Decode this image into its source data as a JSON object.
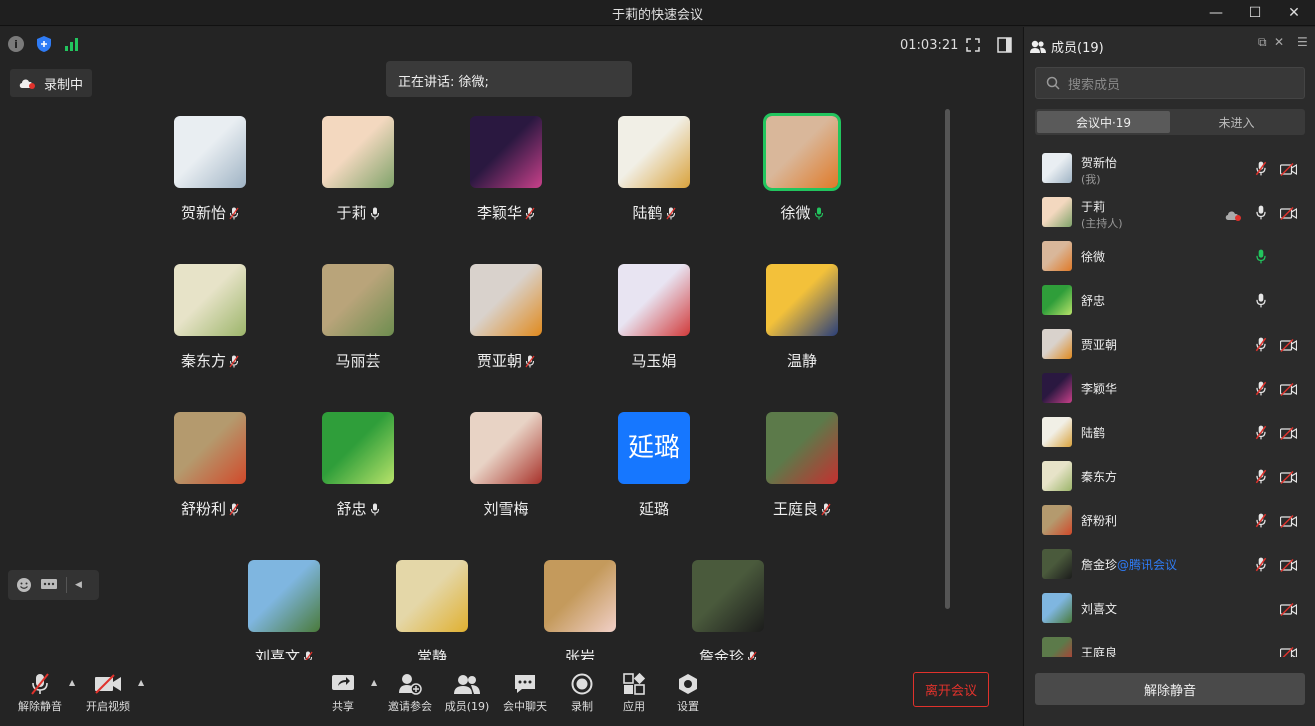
{
  "window": {
    "title": "于莉的快速会议"
  },
  "header": {
    "timer": "01:03:21",
    "recording_label": "录制中",
    "speaking_label": "正在讲话: 徐微;"
  },
  "colors": {
    "accent_green": "#22c55e",
    "danger_red": "#e0322c",
    "link_blue": "#2f7cf6"
  },
  "grid": [
    {
      "name": "贺新怡",
      "mic": "muted",
      "av": [
        "#e9eef2",
        "#9fb3c4"
      ]
    },
    {
      "name": "于莉",
      "mic": "on",
      "av": [
        "#f3d8bf",
        "#7fa36a"
      ]
    },
    {
      "name": "李颖华",
      "mic": "muted",
      "av": [
        "#2a1840",
        "#c8408a"
      ]
    },
    {
      "name": "陆鹤",
      "mic": "muted",
      "av": [
        "#f1efe6",
        "#d9a23c"
      ]
    },
    {
      "name": "徐微",
      "mic": "talking",
      "av": [
        "#d9b79a",
        "#e07a28"
      ],
      "active": true
    },
    {
      "name": "秦东方",
      "mic": "muted",
      "av": [
        "#e7e3c8",
        "#9cb56a"
      ]
    },
    {
      "name": "马丽芸",
      "mic": "none",
      "av": [
        "#b9a47a",
        "#6d8d4f"
      ]
    },
    {
      "name": "贾亚朝",
      "mic": "muted",
      "av": [
        "#d9d2cc",
        "#e08a1e"
      ]
    },
    {
      "name": "马玉娟",
      "mic": "none",
      "av": [
        "#e8e4f2",
        "#d13a3a"
      ]
    },
    {
      "name": "温静",
      "mic": "none",
      "av": [
        "#f3c13a",
        "#2a3f7a"
      ]
    },
    {
      "name": "舒粉利",
      "mic": "muted",
      "av": [
        "#b49a6e",
        "#d1492a"
      ]
    },
    {
      "name": "舒忠",
      "mic": "on",
      "av": [
        "#2f9e3a",
        "#b8e36a"
      ]
    },
    {
      "name": "刘雪梅",
      "mic": "none",
      "av": [
        "#e8d3c5",
        "#a8322a"
      ]
    },
    {
      "name": "延璐",
      "mic": "none",
      "av": [
        "#1677ff",
        "#1677ff"
      ],
      "text": "延璐"
    },
    {
      "name": "王庭良",
      "mic": "muted",
      "av": [
        "#5c7a4a",
        "#c53030"
      ]
    },
    {
      "name": "刘喜文",
      "mic": "muted",
      "av": [
        "#7fb6e0",
        "#4a7a3a"
      ]
    },
    {
      "name": "常静",
      "mic": "none",
      "av": [
        "#e4d7a8",
        "#e0b030"
      ]
    },
    {
      "name": "张岩",
      "mic": "none",
      "av": [
        "#c49a5c",
        "#f1d0c8"
      ]
    },
    {
      "name": "詹金珍",
      "mic": "muted",
      "av": [
        "#4a5a3c",
        "#1c1c1c"
      ]
    }
  ],
  "toolbar": {
    "unmute": "解除静音",
    "start_video": "开启视频",
    "share": "共享",
    "invite": "邀请参会",
    "members": "成员(19)",
    "chat": "会中聊天",
    "record": "录制",
    "apps": "应用",
    "settings": "设置",
    "leave": "离开会议"
  },
  "sidebar": {
    "title": "成员(19)",
    "search_placeholder": "搜索成员",
    "tab_in": "会议中·19",
    "tab_out": "未进入",
    "unmute_all": "解除静音",
    "members": [
      {
        "name": "贺新怡",
        "sub": "(我)",
        "mic": "muted",
        "cam": "off",
        "av": [
          "#e9eef2",
          "#9fb3c4"
        ]
      },
      {
        "name": "于莉",
        "sub": "(主持人)",
        "mic": "on",
        "cam": "off",
        "cloud": true,
        "av": [
          "#f3d8bf",
          "#7fa36a"
        ]
      },
      {
        "name": "徐微",
        "mic": "talking",
        "cam": "none",
        "av": [
          "#d9b79a",
          "#e07a28"
        ]
      },
      {
        "name": "舒忠",
        "mic": "on",
        "cam": "none",
        "av": [
          "#2f9e3a",
          "#b8e36a"
        ]
      },
      {
        "name": "贾亚朝",
        "mic": "muted",
        "cam": "off",
        "av": [
          "#d9d2cc",
          "#e08a1e"
        ]
      },
      {
        "name": "李颖华",
        "mic": "muted",
        "cam": "off",
        "av": [
          "#2a1840",
          "#c8408a"
        ]
      },
      {
        "name": "陆鹤",
        "mic": "muted",
        "cam": "off",
        "av": [
          "#f1efe6",
          "#d9a23c"
        ]
      },
      {
        "name": "秦东方",
        "mic": "muted",
        "cam": "off",
        "av": [
          "#e7e3c8",
          "#9cb56a"
        ]
      },
      {
        "name": "舒粉利",
        "mic": "muted",
        "cam": "off",
        "av": [
          "#b49a6e",
          "#d1492a"
        ]
      },
      {
        "name": "詹金珍",
        "tag": "@腾讯会议",
        "mic": "muted",
        "cam": "off",
        "av": [
          "#4a5a3c",
          "#1c1c1c"
        ]
      },
      {
        "name": "刘喜文",
        "mic": "none",
        "cam": "off",
        "av": [
          "#7fb6e0",
          "#4a7a3a"
        ]
      },
      {
        "name": "王庭良",
        "mic": "none",
        "cam": "off",
        "av": [
          "#5c7a4a",
          "#c53030"
        ]
      }
    ]
  }
}
